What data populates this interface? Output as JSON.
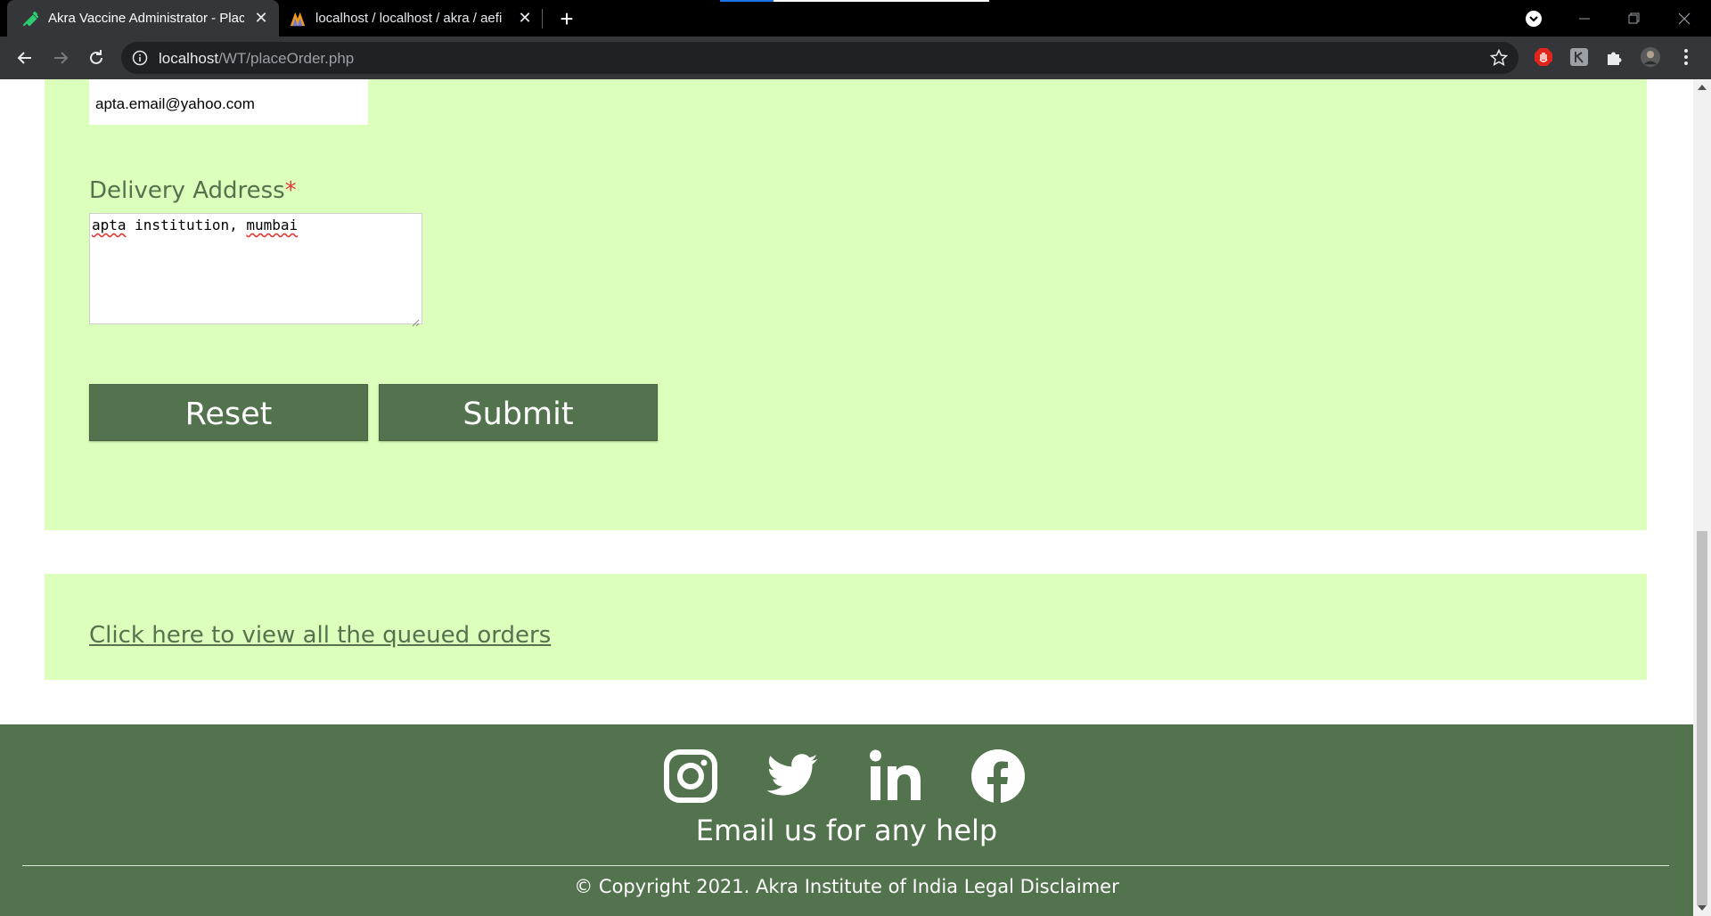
{
  "browser": {
    "tabs": [
      {
        "title": "Akra Vaccine Administrator - Plac",
        "icon": "syringe-icon",
        "active": true
      },
      {
        "title": "localhost / localhost / akra / aefi",
        "icon": "phpmyadmin-icon",
        "active": false
      }
    ],
    "url_host": "localhost",
    "url_path": "/WT/placeOrder.php"
  },
  "form": {
    "email_value": "apta.email@yahoo.com",
    "address_label": "Delivery Address",
    "required_marker": "*",
    "address_words": [
      "apta",
      " institution, ",
      "mumbai"
    ],
    "reset_label": "Reset",
    "submit_label": "Submit"
  },
  "queue_link_text": "Click here to view all the queued orders",
  "footer": {
    "social_icons": [
      "instagram-icon",
      "twitter-icon",
      "linkedin-icon",
      "facebook-icon"
    ],
    "help_text": "Email us for any help",
    "copyright": "© Copyright 2021. Akra Institute of India Legal Disclaimer"
  },
  "colors": {
    "panel_bg": "#ddffbc",
    "accent_green": "#52734d",
    "required_red": "#e53935"
  }
}
